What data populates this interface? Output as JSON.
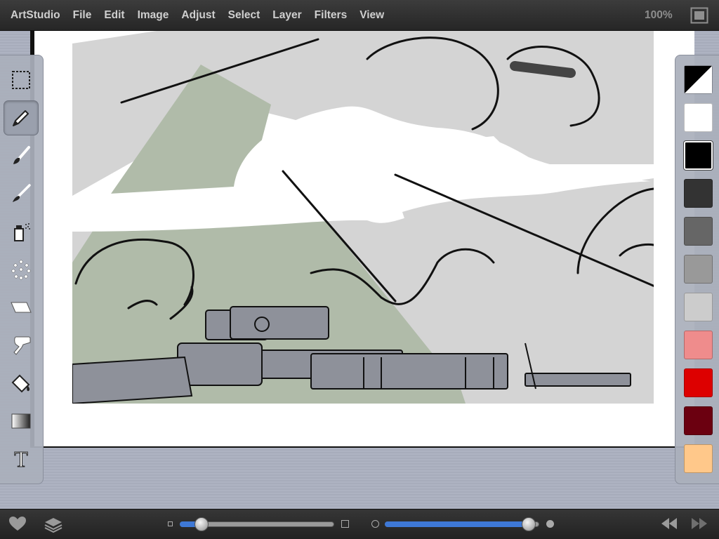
{
  "menubar": {
    "app_name": "ArtStudio",
    "items": [
      "File",
      "Edit",
      "Image",
      "Adjust",
      "Select",
      "Layer",
      "Filters",
      "View"
    ],
    "zoom": "100%",
    "fullscreen_icon": "fullscreen-icon"
  },
  "tools": [
    {
      "name": "selection-tool",
      "icon": "marquee-icon",
      "active": false
    },
    {
      "name": "pencil-tool",
      "icon": "pencil-icon",
      "active": true
    },
    {
      "name": "brush-tool",
      "icon": "brush-icon",
      "active": false
    },
    {
      "name": "smudge-tool",
      "icon": "smudge-icon",
      "active": false
    },
    {
      "name": "spray-tool",
      "icon": "spray-can-icon",
      "active": false
    },
    {
      "name": "scatter-tool",
      "icon": "dots-icon",
      "active": false
    },
    {
      "name": "eraser-tool",
      "icon": "eraser-icon",
      "active": false
    },
    {
      "name": "blur-tool",
      "icon": "blur-icon",
      "active": false
    },
    {
      "name": "fill-tool",
      "icon": "paint-bucket-icon",
      "active": false
    },
    {
      "name": "gradient-tool",
      "icon": "gradient-icon",
      "active": false
    },
    {
      "name": "text-tool",
      "icon": "text-icon",
      "label": "T",
      "active": false
    }
  ],
  "colors": {
    "primary_secondary": [
      "#000000",
      "#ffffff"
    ],
    "swatches": [
      "#ffffff",
      "#000000",
      "#333333",
      "#666666",
      "#999999",
      "#cccccc",
      "#ef8c8c",
      "#dd0000",
      "#6b0010",
      "#ffc88a"
    ],
    "selected_index": 1
  },
  "bottombar": {
    "favorite_icon": "heart-icon",
    "layers_icon": "layers-icon",
    "size_slider_value": 0.14,
    "opacity_slider_value": 0.93,
    "undo_icon": "rewind-icon",
    "redo_icon": "fast-forward-icon"
  },
  "canvas": {
    "accent_green": "#b0bba9",
    "sky_gray": "#d4d4d4",
    "rifle_gray": "#8e919a"
  }
}
